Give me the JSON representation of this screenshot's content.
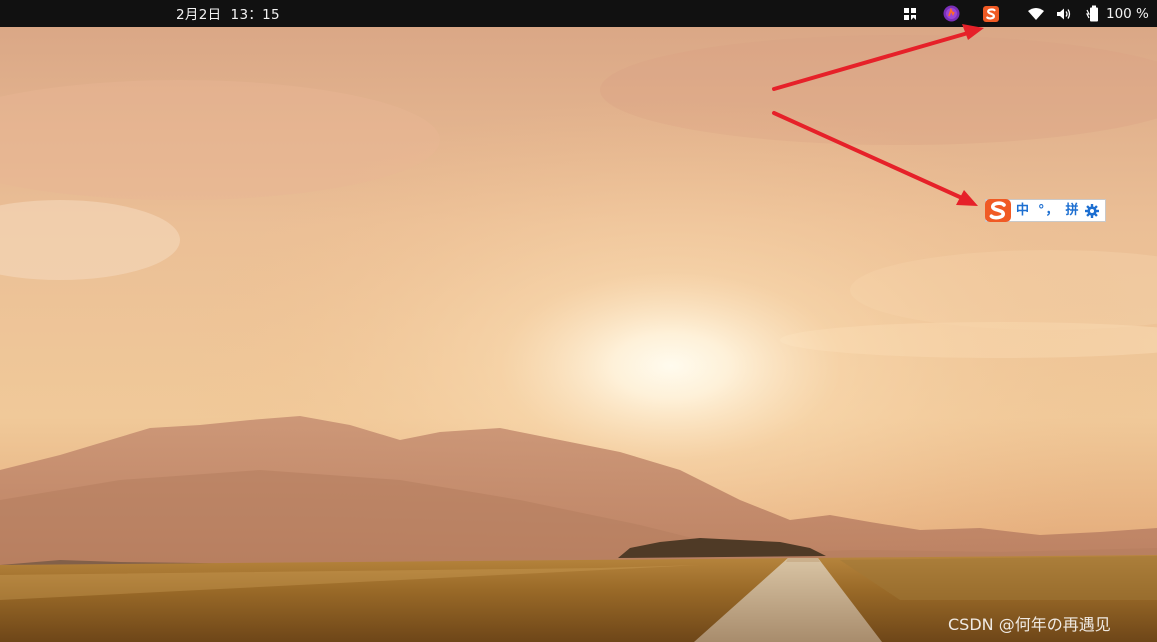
{
  "topbar": {
    "clock": "2月2日  13：15",
    "battery_percent": "100 %",
    "tray_icons": [
      "panel-grid-icon",
      "app-launcher-icon",
      "sogou-ime-icon",
      "wifi-icon",
      "volume-icon",
      "battery-icon"
    ]
  },
  "ime_bar": {
    "logo": "sogou-logo-icon",
    "language": "中",
    "punctuation": "°，",
    "input_mode": "拼",
    "settings": "gear-icon"
  },
  "annotation": {
    "arrow_color": "#e62129",
    "arrows": [
      "arrow-to-tray-icon",
      "arrow-to-ime-bar"
    ]
  },
  "watermark": {
    "text": "CSDN @何年の再遇见"
  },
  "colors": {
    "topbar_bg": "#111111",
    "sogou_orange": "#f05a24",
    "ime_text_blue": "#1d6fd1"
  }
}
